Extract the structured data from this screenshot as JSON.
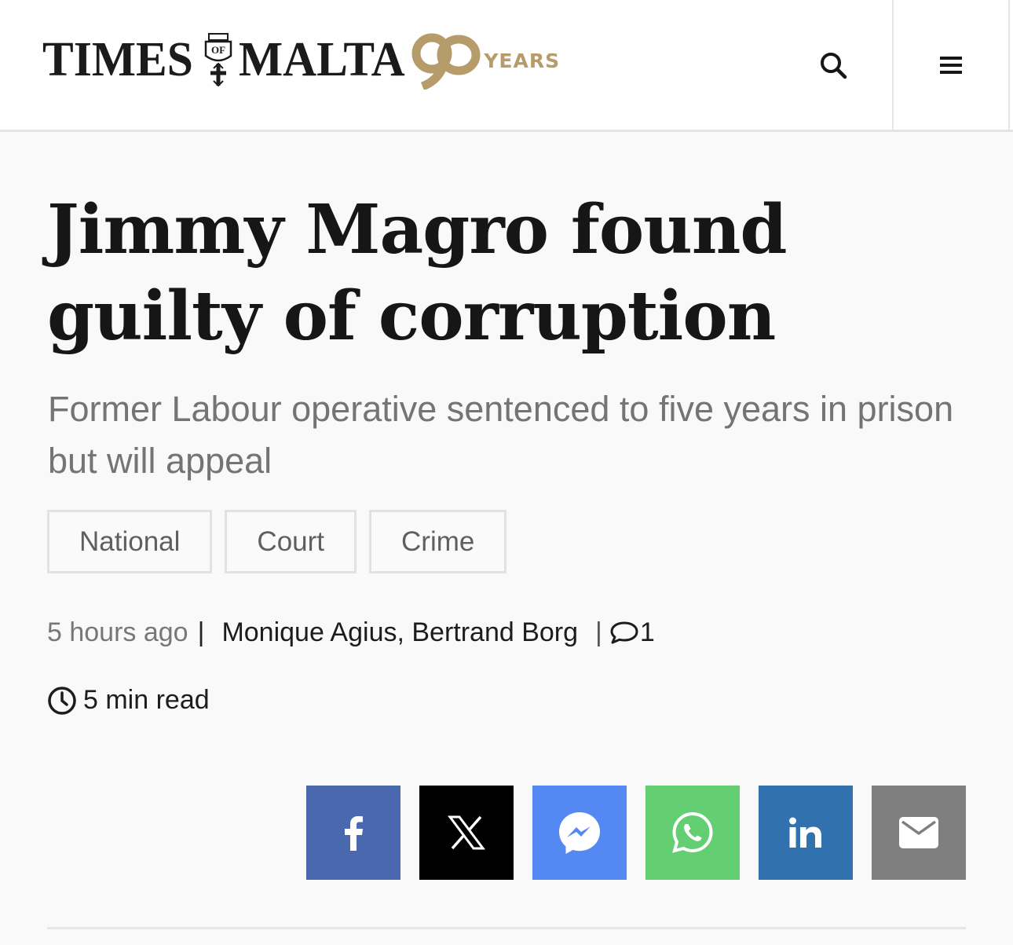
{
  "header": {
    "logo_left": "TIMES",
    "logo_right": "MALTA",
    "anniversary_suffix": "YEARS",
    "icons": [
      "crest-icon",
      "search-icon",
      "hamburger-menu-icon"
    ]
  },
  "article": {
    "headline": "Jimmy Magro found guilty of corruption",
    "subheadline": "Former Labour operative sentenced to five years in prison but will appeal",
    "tags": [
      "National",
      "Court",
      "Crime"
    ],
    "published": "5 hours ago",
    "authors": "Monique Agius, Bertrand Borg",
    "comment_count": "1",
    "read_time": "5 min read"
  },
  "share": {
    "buttons": [
      {
        "name": "facebook",
        "color": "#4968ad"
      },
      {
        "name": "x",
        "color": "#000000"
      },
      {
        "name": "messenger",
        "color": "#5489f3"
      },
      {
        "name": "whatsapp",
        "color": "#63cf72"
      },
      {
        "name": "linkedin",
        "color": "#3171ad"
      },
      {
        "name": "email",
        "color": "#7f7f7f"
      }
    ]
  },
  "colors": {
    "accent_gold": "#b79c6b",
    "text_dark": "#161616",
    "text_muted": "#747474"
  }
}
